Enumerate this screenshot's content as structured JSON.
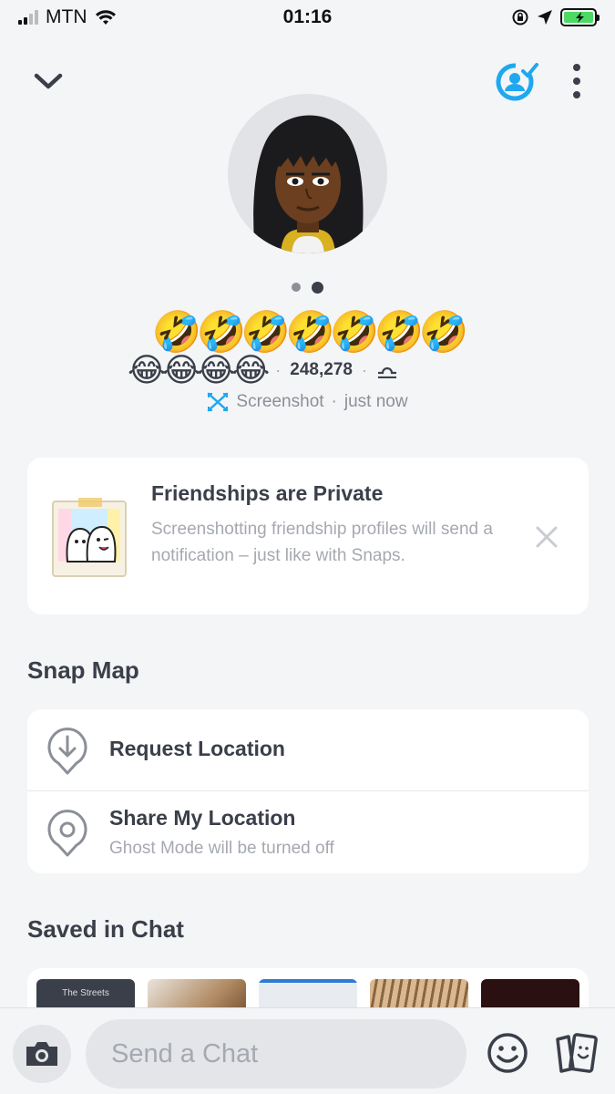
{
  "status_bar": {
    "carrier": "MTN",
    "time": "01:16"
  },
  "profile": {
    "name_emoji": "🤣🤣🤣🤣🤣🤣🤣",
    "meta_emoji": "😂😂😂😂",
    "score": "248,278",
    "zodiac_icon": "libra-icon",
    "separator": "·"
  },
  "screenshot_notice": {
    "label": "Screenshot",
    "separator": "·",
    "time": "just now"
  },
  "private_card": {
    "title": "Friendships are Private",
    "body": "Screenshotting friendship profiles will send a notification – just like with Snaps."
  },
  "snap_map": {
    "title": "Snap Map",
    "items": [
      {
        "label": "Request Location",
        "icon": "download-pin-icon"
      },
      {
        "label": "Share My Location",
        "sub": "Ghost Mode will be turned off",
        "icon": "location-pin-icon"
      }
    ]
  },
  "saved_in_chat": {
    "title": "Saved in Chat",
    "thumbs": [
      {
        "label": "The Streets",
        "color": "#3a3f4a"
      },
      {
        "label": "",
        "color": "#b08a63"
      },
      {
        "label": "",
        "color": "#d7dde4"
      },
      {
        "label": "",
        "color": "#c5a27a"
      },
      {
        "label": "",
        "color": "#2a1010"
      }
    ]
  },
  "chat_bar": {
    "placeholder": "Send a Chat"
  },
  "colors": {
    "accent": "#1fa8f0",
    "text": "#3a3f4a",
    "muted": "#a5a9b0",
    "background": "#f4f5f7"
  }
}
